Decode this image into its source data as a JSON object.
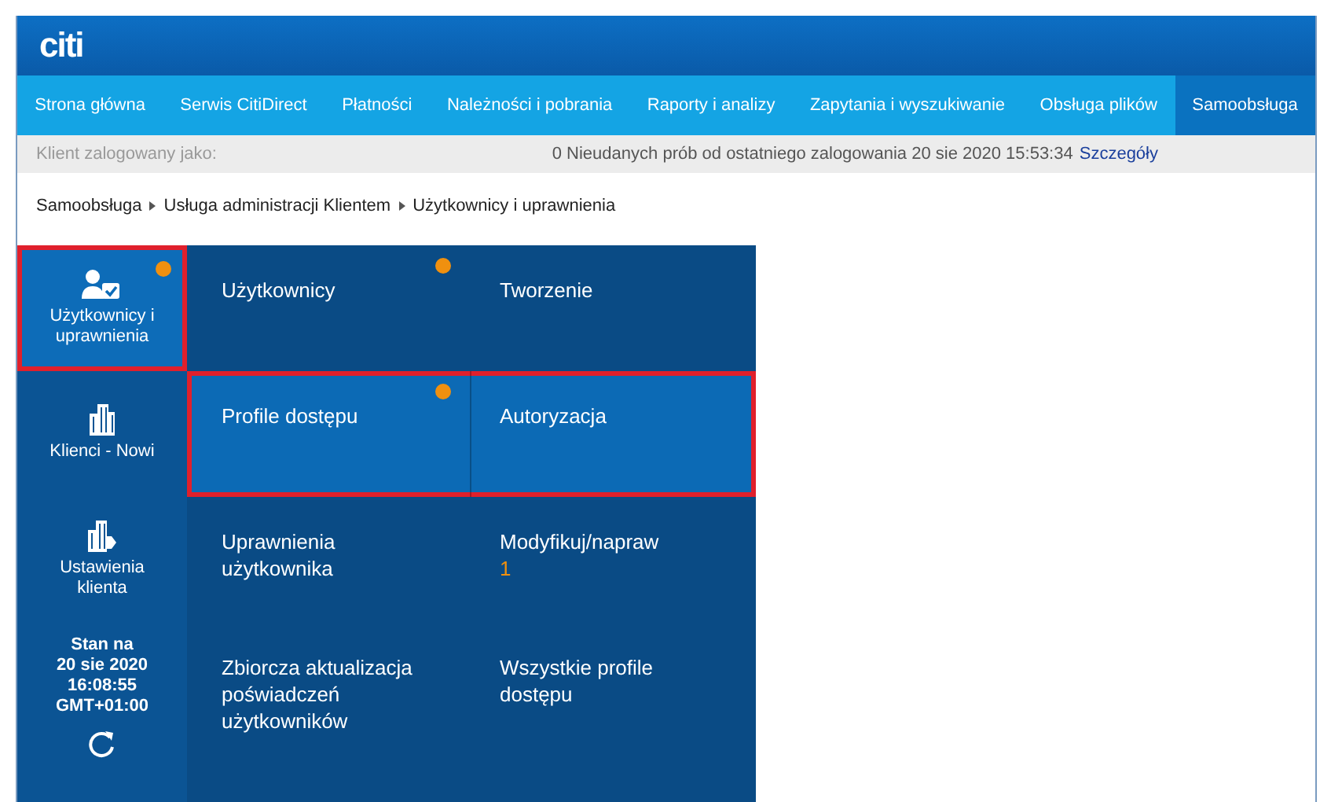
{
  "header": {
    "logo": "citi"
  },
  "nav": [
    {
      "label": "Strona główna",
      "selected": false
    },
    {
      "label": "Serwis CitiDirect",
      "selected": false
    },
    {
      "label": "Płatności",
      "selected": false
    },
    {
      "label": "Należności i pobrania",
      "selected": false
    },
    {
      "label": "Raporty i analizy",
      "selected": false
    },
    {
      "label": "Zapytania i wyszukiwanie",
      "selected": false
    },
    {
      "label": "Obsługa plików",
      "selected": false
    },
    {
      "label": "Samoobsługa",
      "selected": true
    }
  ],
  "info_bar": {
    "client_label": "Klient zalogowany jako:",
    "login_message": "0 Nieudanych prób od ostatniego zalogowania 20 sie 2020 15:53:34",
    "details_link": "Szczegóły"
  },
  "breadcrumb": [
    "Samoobsługa",
    "Usługa administracji Klientem",
    "Użytkownicy i uprawnienia"
  ],
  "sidebar": {
    "items": [
      {
        "label": "Użytkownicy i uprawnienia",
        "kind": "users",
        "selected": true,
        "highlighted": true,
        "dot": true
      },
      {
        "label": "Klienci - Nowi",
        "kind": "building",
        "selected": false,
        "highlighted": false,
        "dot": false
      },
      {
        "label": "Ustawienia klienta",
        "kind": "building-settings",
        "selected": false,
        "highlighted": false,
        "dot": false
      }
    ],
    "status": {
      "lines": [
        "Stan na",
        "20 sie 2020",
        "16:08:55",
        "GMT+01:00"
      ]
    }
  },
  "menu_rows": [
    {
      "selected": false,
      "highlighted": false,
      "cells": [
        {
          "label": "Użytkownicy",
          "dot": true
        },
        {
          "label": "Tworzenie",
          "dot": false
        }
      ]
    },
    {
      "selected": true,
      "highlighted": true,
      "cells": [
        {
          "label": "Profile dostępu",
          "dot": true
        },
        {
          "label": "Autoryzacja",
          "dot": false
        }
      ]
    },
    {
      "selected": false,
      "highlighted": false,
      "cells": [
        {
          "label": "Uprawnienia użytkownika",
          "dot": false
        },
        {
          "label": "Modyfikuj/napraw",
          "dot": false,
          "count": "1"
        }
      ]
    },
    {
      "selected": false,
      "highlighted": false,
      "cells": [
        {
          "label": "Zbiorcza aktualizacja poświadczeń użytkowników",
          "dot": false
        },
        {
          "label": "Wszystkie profile dostępu",
          "dot": false
        }
      ]
    }
  ]
}
